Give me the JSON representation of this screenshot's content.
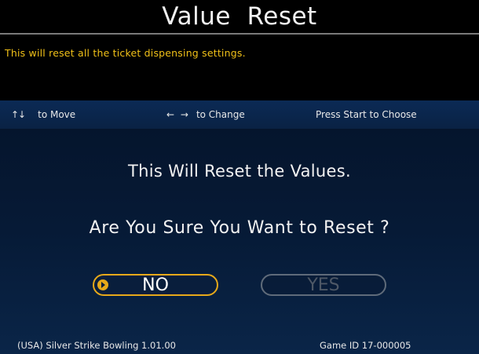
{
  "window": {
    "title": "Value  Reset"
  },
  "description": "This will reset all the ticket dispensing settings.",
  "nav_hints": {
    "move_arrows": "↑↓",
    "move_label": "to Move",
    "change_arrows": "← →",
    "change_label": "to Change",
    "choose_label": "Press Start to Choose"
  },
  "dialog": {
    "message": "This Will Reset the Values.",
    "question": "Are You Sure You Want to Reset ?",
    "no_label": "NO",
    "yes_label": "YES",
    "selected": "NO",
    "cursor_icon": "play-circle-icon"
  },
  "footer": {
    "game_info": "(USA) Silver Strike Bowling 1.01.00",
    "game_id": "Game ID 17-000005"
  },
  "colors": {
    "title_text": "#f2f2f2",
    "description_text": "#f0c018",
    "selection_accent": "#e7a91a",
    "disabled_button": "#5f6b7a",
    "panel_blue": "#0a2244"
  }
}
